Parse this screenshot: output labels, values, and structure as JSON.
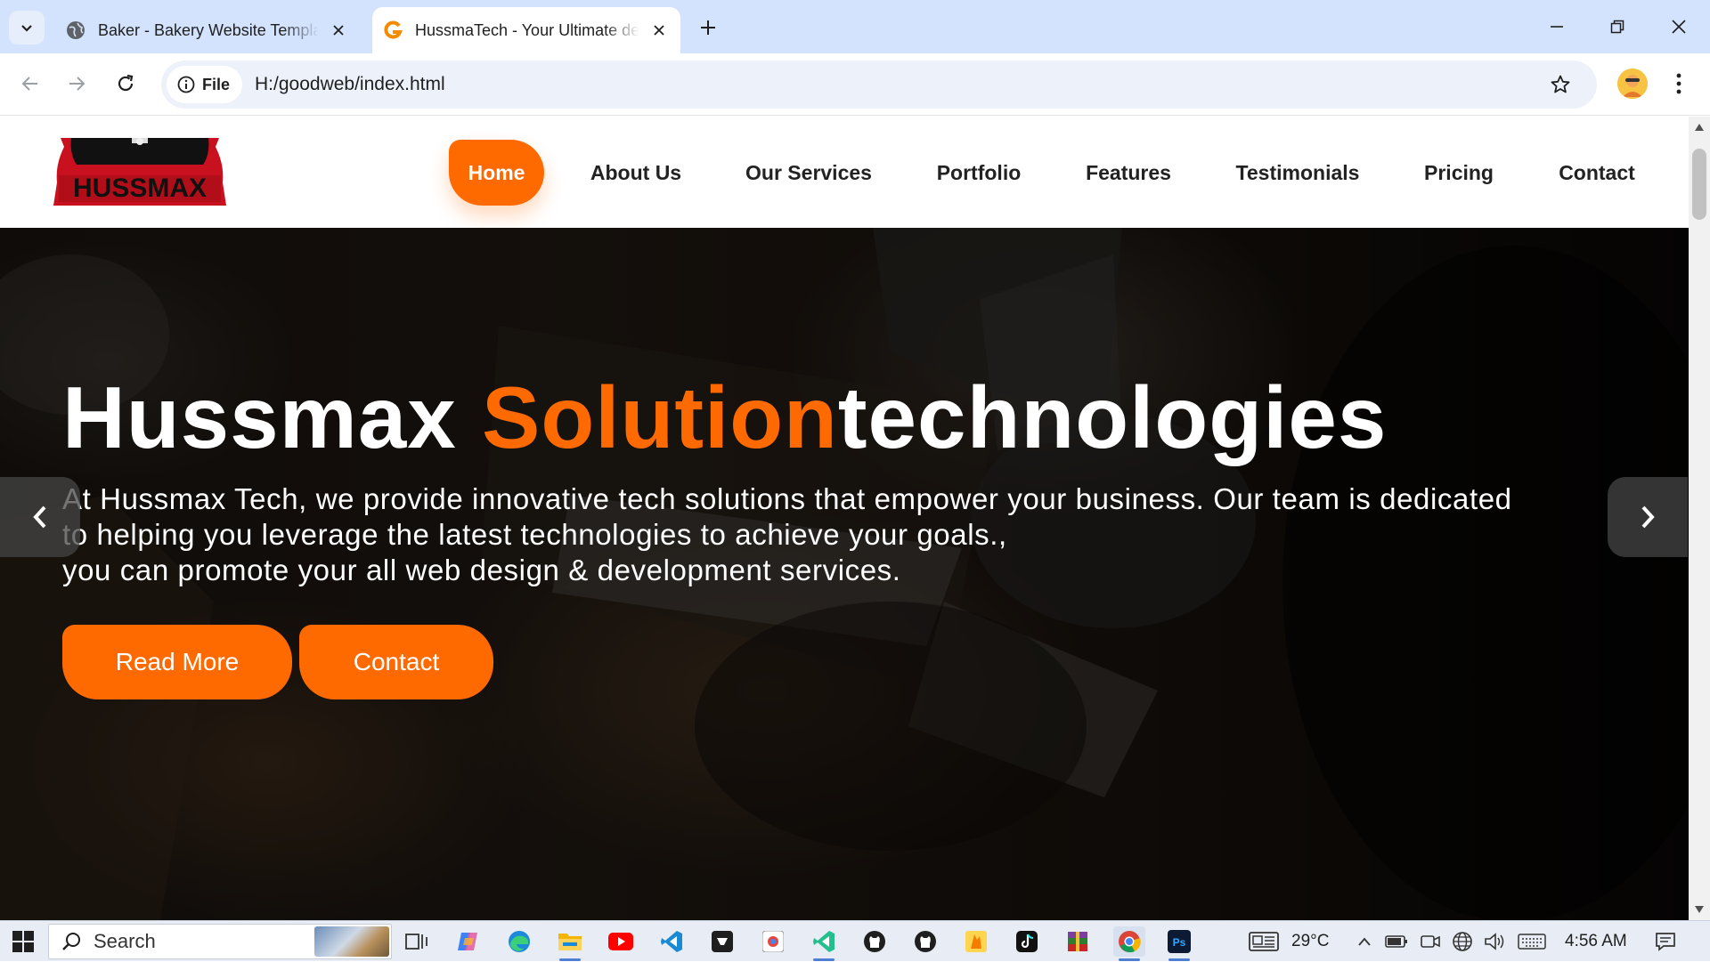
{
  "browser": {
    "tabs": [
      {
        "title": "Baker - Bakery Website Template",
        "active": false,
        "favicon": "globe-icon"
      },
      {
        "title": "HussmaTech - Your Ultimate destination",
        "active": true,
        "favicon": "hussmatech-favicon"
      }
    ],
    "omnibox": {
      "chip_label": "File",
      "url": "H:/goodweb/index.html"
    }
  },
  "site": {
    "logo_text": "HUSSMAX",
    "nav": [
      {
        "label": "Home",
        "active": true
      },
      {
        "label": "About Us"
      },
      {
        "label": "Our Services"
      },
      {
        "label": "Portfolio"
      },
      {
        "label": "Features"
      },
      {
        "label": "Testimonials"
      },
      {
        "label": "Pricing"
      },
      {
        "label": "Contact"
      }
    ],
    "hero": {
      "title_part1": "Hussmax ",
      "title_accent": "Solution",
      "title_part2": "technologies",
      "text_line1": "At Hussmax Tech, we provide innovative tech solutions that empower your business. Our team is dedicated",
      "text_line2": "to helping you leverage the latest technologies to achieve your goals.,",
      "text_line3": "you can promote your all web design & development services.",
      "btn_read_more": "Read More",
      "btn_contact": "Contact"
    },
    "colors": {
      "accent": "#ff6a00",
      "nav_text": "#222222"
    }
  },
  "taskbar": {
    "search_label": "Search",
    "weather": "29°C",
    "time": "4:56 AM"
  }
}
